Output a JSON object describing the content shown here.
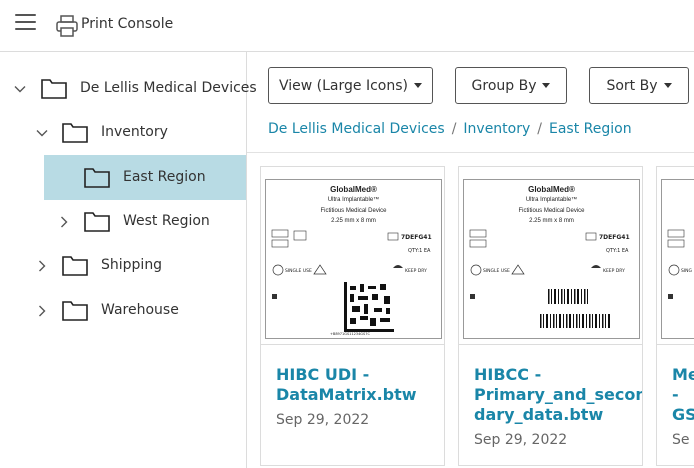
{
  "app": {
    "title": "Print Console"
  },
  "tree": [
    {
      "label": "De Lellis Medical Devices",
      "expanded": true
    },
    {
      "label": "Inventory",
      "expanded": true
    },
    {
      "label": "East Region",
      "selected": true
    },
    {
      "label": "West Region",
      "expanded": false
    },
    {
      "label": "Shipping",
      "expanded": false
    },
    {
      "label": "Warehouse",
      "expanded": false
    }
  ],
  "toolbar": {
    "view_label": "View (Large Icons)",
    "group_label": "Group By",
    "sort_label": "Sort By"
  },
  "breadcrumb": [
    "De Lellis Medical Devices",
    "Inventory",
    "East Region"
  ],
  "documents": [
    {
      "name_line1": "HIBC UDI -",
      "name_line2": "DataMatrix.btw",
      "date": "Sep 29, 2022"
    },
    {
      "name_line1": "HIBCC -",
      "name_line2": "Primary_and_secon",
      "name_line3": "dary_data.btw",
      "date": "Sep 29, 2022"
    },
    {
      "name_line1": "Me",
      "name_line2": "-",
      "name_line3": "GS",
      "date": "Se"
    }
  ],
  "label_preview": {
    "brand": "GlobalMed®",
    "product": "Ultra Implantable™",
    "device": "Fictitious Medical Device",
    "size": "2.25 mm x 8 mm",
    "sn": "7DEFG41",
    "qty": "QTY:1 EA",
    "single_use": "SINGLE USE",
    "keep_dry": "KEEP DRY",
    "barcode_text": "+B8971GS11234GS7C"
  },
  "colors": {
    "accent": "#1a86a8",
    "selected_bg": "#b8dbe4"
  }
}
